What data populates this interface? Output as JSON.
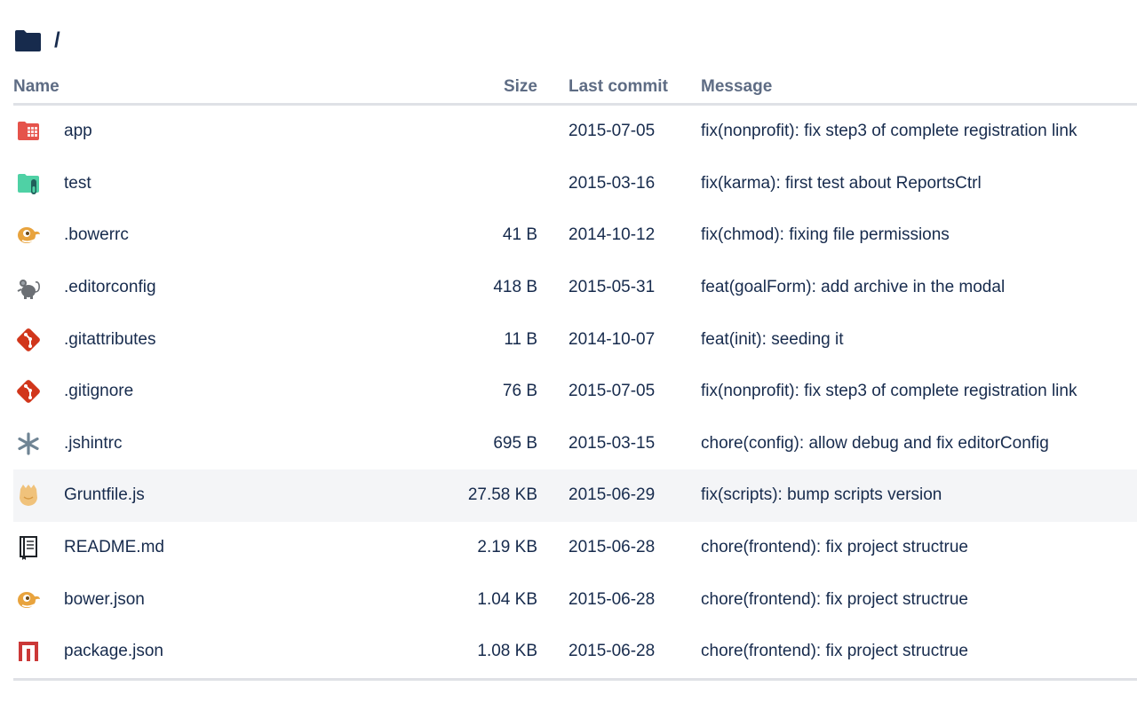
{
  "breadcrumb": {
    "icon": "folder-icon",
    "path": "/"
  },
  "table": {
    "headers": {
      "name": "Name",
      "size": "Size",
      "last_commit": "Last commit",
      "message": "Message"
    },
    "rows": [
      {
        "icon": "app-folder-icon",
        "name": "app",
        "size": "",
        "date": "2015-07-05",
        "message": "fix(nonprofit): fix step3 of complete registration link"
      },
      {
        "icon": "test-folder-icon",
        "name": "test",
        "size": "",
        "date": "2015-03-16",
        "message": "fix(karma): first test about ReportsCtrl"
      },
      {
        "icon": "bower-icon",
        "name": ".bowerrc",
        "size": "41 B",
        "date": "2014-10-12",
        "message": "fix(chmod): fixing file permissions"
      },
      {
        "icon": "editorconfig-mouse-icon",
        "name": ".editorconfig",
        "size": "418 B",
        "date": "2015-05-31",
        "message": "feat(goalForm): add archive in the modal"
      },
      {
        "icon": "git-icon",
        "name": ".gitattributes",
        "size": "11 B",
        "date": "2014-10-07",
        "message": "feat(init): seeding it"
      },
      {
        "icon": "git-icon",
        "name": ".gitignore",
        "size": "76 B",
        "date": "2015-07-05",
        "message": "fix(nonprofit): fix step3 of complete registration link"
      },
      {
        "icon": "asterisk-icon",
        "name": ".jshintrc",
        "size": "695 B",
        "date": "2015-03-15",
        "message": "chore(config): allow debug and fix editorConfig"
      },
      {
        "icon": "grunt-icon",
        "name": "Gruntfile.js",
        "size": "27.58 KB",
        "date": "2015-06-29",
        "message": "fix(scripts): bump scripts version"
      },
      {
        "icon": "readme-book-icon",
        "name": "README.md",
        "size": "2.19 KB",
        "date": "2015-06-28",
        "message": "chore(frontend): fix project structrue"
      },
      {
        "icon": "bower-icon",
        "name": "bower.json",
        "size": "1.04 KB",
        "date": "2015-06-28",
        "message": "chore(frontend): fix project structrue"
      },
      {
        "icon": "npm-icon",
        "name": "package.json",
        "size": "1.08 KB",
        "date": "2015-06-28",
        "message": "chore(frontend): fix project structrue"
      }
    ]
  },
  "colors": {
    "header_text": "#5e6c84",
    "body_text": "#172b4d",
    "hover_row": "#f4f5f7",
    "divider": "#dfe1e6",
    "app_folder": "#e5534b",
    "test_folder": "#4fd1a5",
    "bower": "#e8a33d",
    "git": "#d1361b",
    "grunt": "#f0c27b",
    "npm": "#cb3837"
  }
}
